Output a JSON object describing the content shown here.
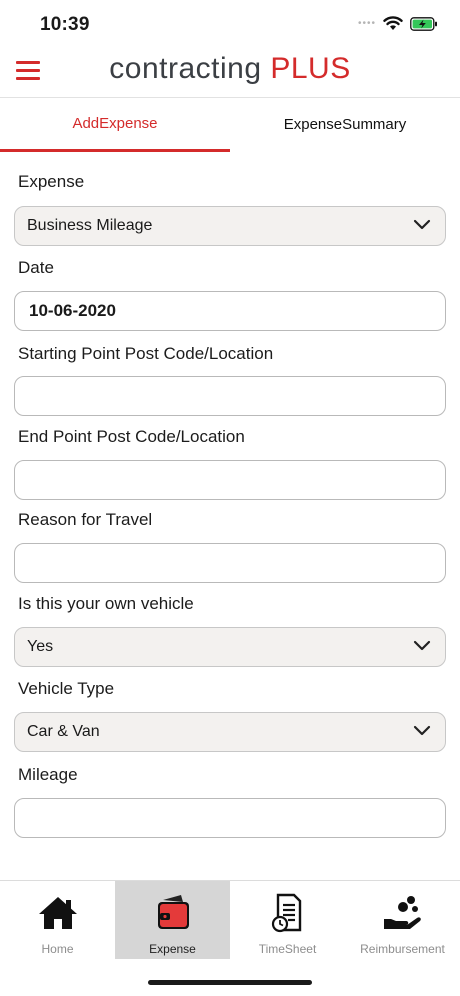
{
  "status_bar": {
    "time": "10:39",
    "signal": "••••"
  },
  "header": {
    "logo_main": "contracting ",
    "logo_accent": "PLUS",
    "accent_color": "#d42b2b"
  },
  "tabs": [
    {
      "label": "AddExpense",
      "active": true
    },
    {
      "label": "ExpenseSummary",
      "active": false
    }
  ],
  "form": {
    "expense": {
      "label": "Expense",
      "value": "Business Mileage"
    },
    "date": {
      "label": "Date",
      "value": "10-06-2020"
    },
    "start": {
      "label": "Starting Point Post Code/Location",
      "value": ""
    },
    "end": {
      "label": "End Point Post Code/Location",
      "value": ""
    },
    "reason": {
      "label": "Reason for Travel",
      "value": ""
    },
    "own_vehicle": {
      "label": "Is this your own vehicle",
      "value": "Yes"
    },
    "vehicle_type": {
      "label": "Vehicle Type",
      "value": "Car & Van"
    },
    "mileage": {
      "label": "Mileage",
      "value": ""
    }
  },
  "bottom_nav": [
    {
      "label": "Home",
      "icon": "home-icon",
      "active": false
    },
    {
      "label": "Expense",
      "icon": "wallet-icon",
      "active": true
    },
    {
      "label": "TimeSheet",
      "icon": "timesheet-icon",
      "active": false
    },
    {
      "label": "Reimbursement",
      "icon": "reimbursement-icon",
      "active": false
    }
  ]
}
